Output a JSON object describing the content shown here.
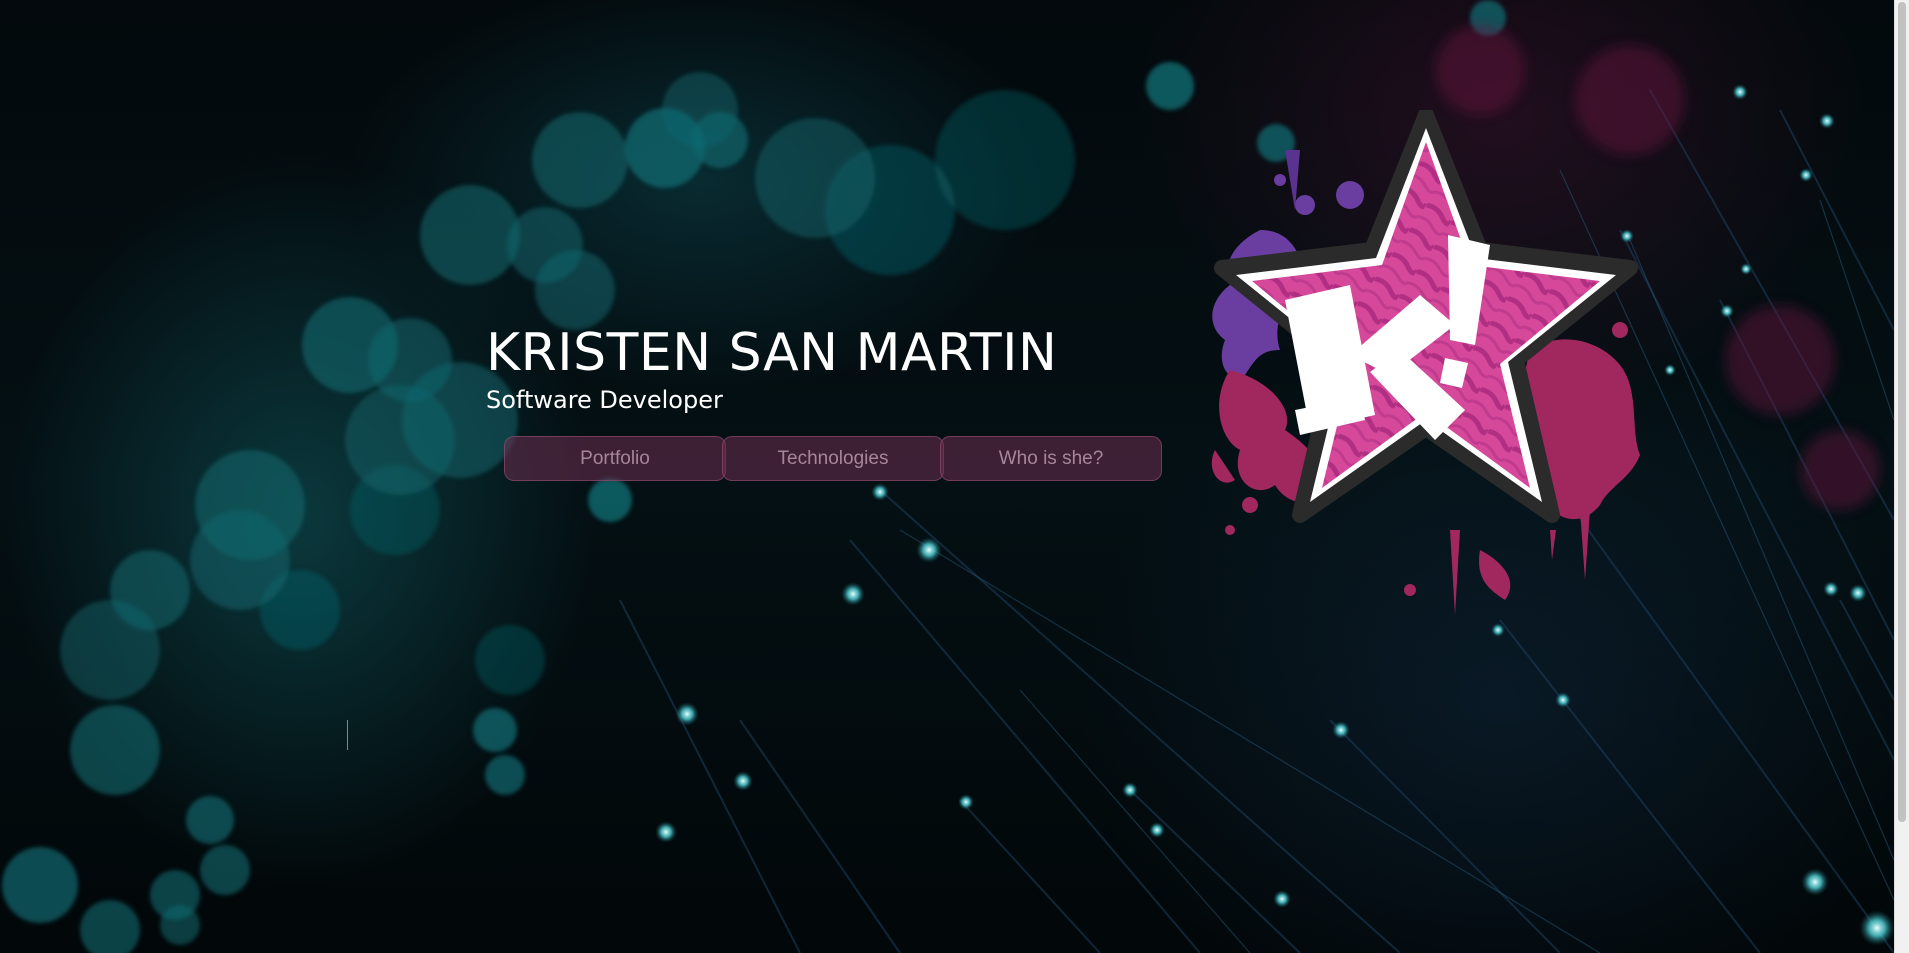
{
  "hero": {
    "name": "KRISTEN SAN MARTIN",
    "tagline": "Software Developer"
  },
  "nav": {
    "items": [
      {
        "label": "Portfolio"
      },
      {
        "label": "Technologies"
      },
      {
        "label": "Who is she?"
      }
    ]
  },
  "logo": {
    "icon": "star-k-logo-icon",
    "text": "k!",
    "colors": {
      "star": "#d6489a",
      "star_stripe": "#b33384",
      "letter": "#ffffff",
      "outline": "#2b2b2b",
      "splash_purple": "#6a3ea1",
      "splash_magenta": "#a0285e"
    }
  },
  "theme": {
    "background": "#02080b",
    "bokeh_teal": "#0d6b70",
    "nav_button_bg": "#5a2a45",
    "nav_button_text": "#c9a5bb"
  }
}
